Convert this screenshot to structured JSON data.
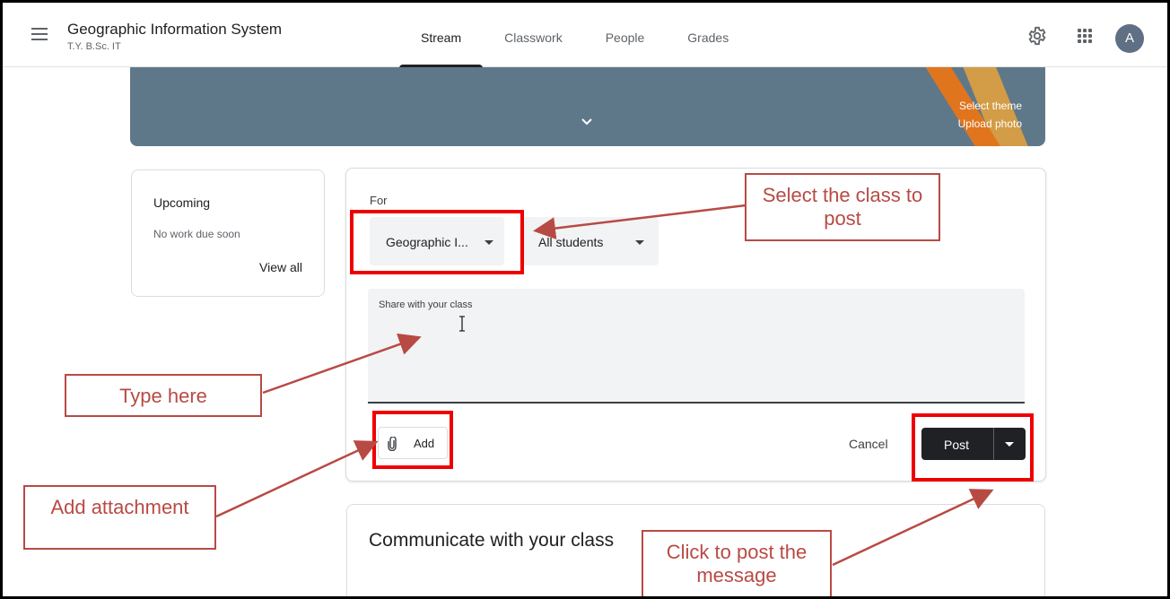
{
  "header": {
    "class_title": "Geographic Information System",
    "class_subtitle": "T.Y. B.Sc. IT",
    "tabs": [
      {
        "label": "Stream",
        "active": true
      },
      {
        "label": "Classwork",
        "active": false
      },
      {
        "label": "People",
        "active": false
      },
      {
        "label": "Grades",
        "active": false
      }
    ],
    "avatar_letter": "A",
    "icons": [
      "menu-icon",
      "gear-icon",
      "apps-grid-icon"
    ]
  },
  "banner": {
    "select_theme": "Select theme",
    "upload_photo": "Upload photo",
    "icon": "chevron-down-icon"
  },
  "upcoming": {
    "title": "Upcoming",
    "subtitle": "No work due soon",
    "view_all": "View all"
  },
  "composer": {
    "for_label": "For",
    "class_select": "Geographic I...",
    "students_select": "All students",
    "share_placeholder": "Share with your class",
    "add_label": "Add",
    "cancel_label": "Cancel",
    "post_label": "Post"
  },
  "communicate": {
    "text": "Communicate with your class"
  },
  "annotations": {
    "select_class": "Select the class to post",
    "type_here": "Type here",
    "add_attachment": "Add attachment",
    "click_post": "Click to post the message",
    "color": "#b84a44",
    "box_color": "#e00000"
  }
}
